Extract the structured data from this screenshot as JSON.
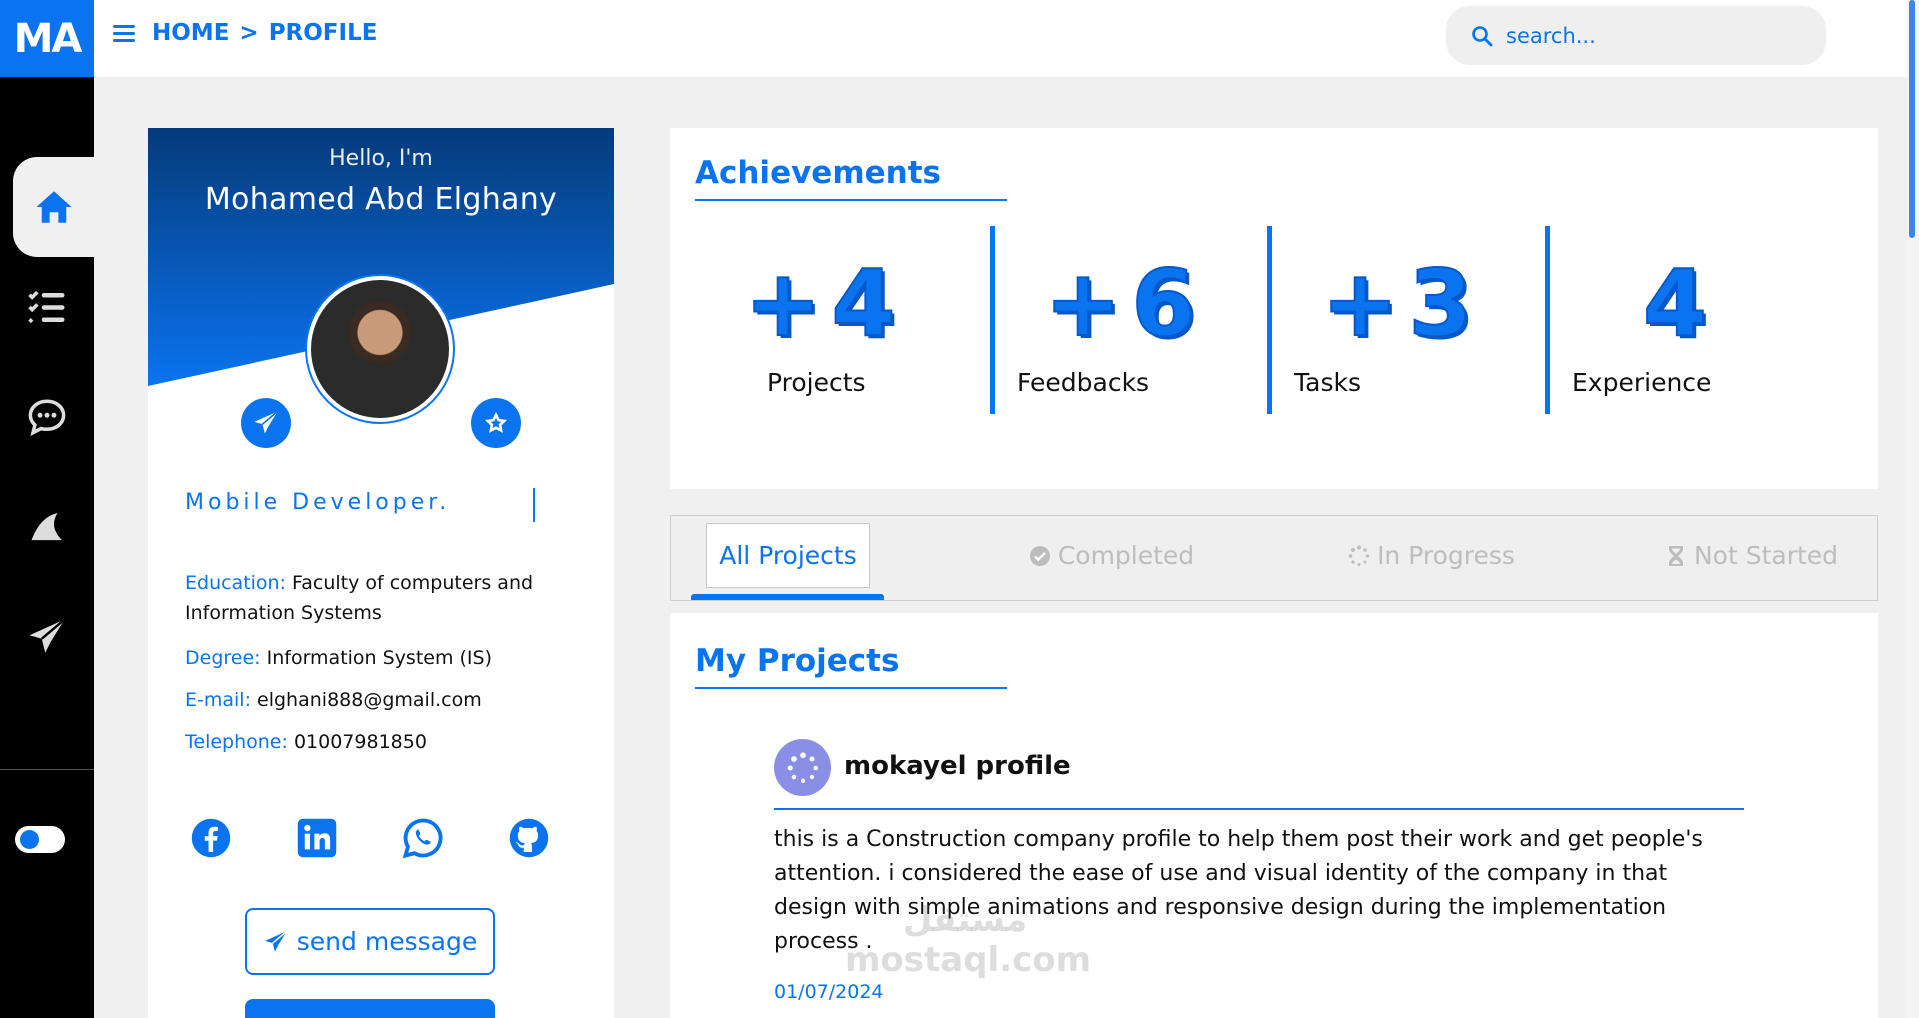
{
  "header": {
    "logo": "MA",
    "breadcrumb": {
      "home": "HOME",
      "separator": ">",
      "current": "PROFILE"
    },
    "search": {
      "placeholder": "search..."
    }
  },
  "sidebar": {
    "items": [
      {
        "icon": "home-icon",
        "active": true
      },
      {
        "icon": "task-list-icon",
        "active": false
      },
      {
        "icon": "chat-icon",
        "active": false
      },
      {
        "icon": "shark-fin-icon",
        "active": false
      },
      {
        "icon": "paper-plane-icon",
        "active": false
      }
    ],
    "toggle": {
      "icon": "theme-toggle-icon",
      "on": false
    }
  },
  "profile": {
    "greeting": "Hello, I'm",
    "name": "Mohamed Abd Elghany",
    "role": "Mobile Developer.",
    "education_label": "Education:",
    "education": "Faculty of computers and Information Systems",
    "degree_label": "Degree:",
    "degree": "Information System (IS)",
    "email_label": "E-mail:",
    "email": "elghani888@gmail.com",
    "telephone_label": "Telephone:",
    "telephone": "01007981850",
    "social": [
      "facebook-icon",
      "linkedin-icon",
      "whatsapp-icon",
      "github-icon"
    ],
    "send_message": "send message"
  },
  "achievements": {
    "title": "Achievements",
    "stats": [
      {
        "value": "+4",
        "label": "Projects"
      },
      {
        "value": "+6",
        "label": "Feedbacks"
      },
      {
        "value": "+3",
        "label": "Tasks"
      },
      {
        "value": "4",
        "label": "Experience"
      }
    ]
  },
  "tabs": [
    {
      "label": "All Projects",
      "active": true
    },
    {
      "label": "Completed",
      "icon": "check-circle-icon"
    },
    {
      "label": "In Progress",
      "icon": "spinner-icon"
    },
    {
      "label": "Not Started",
      "icon": "hourglass-icon"
    }
  ],
  "projects": {
    "title": "My Projects",
    "items": [
      {
        "name": "mokayel profile",
        "description": "this is a Construction company profile to help them post their work and get people's attention. i considered the ease of use and visual identity of the company in that design with simple animations and responsive design during the implementation process .",
        "date": "01/07/2024"
      }
    ]
  },
  "watermark": {
    "arabic": "مستقل",
    "latin": "mostaql.com"
  },
  "colors": {
    "accent": "#0a74f0",
    "sidebar": "#000000",
    "background": "#f0f0f0"
  }
}
